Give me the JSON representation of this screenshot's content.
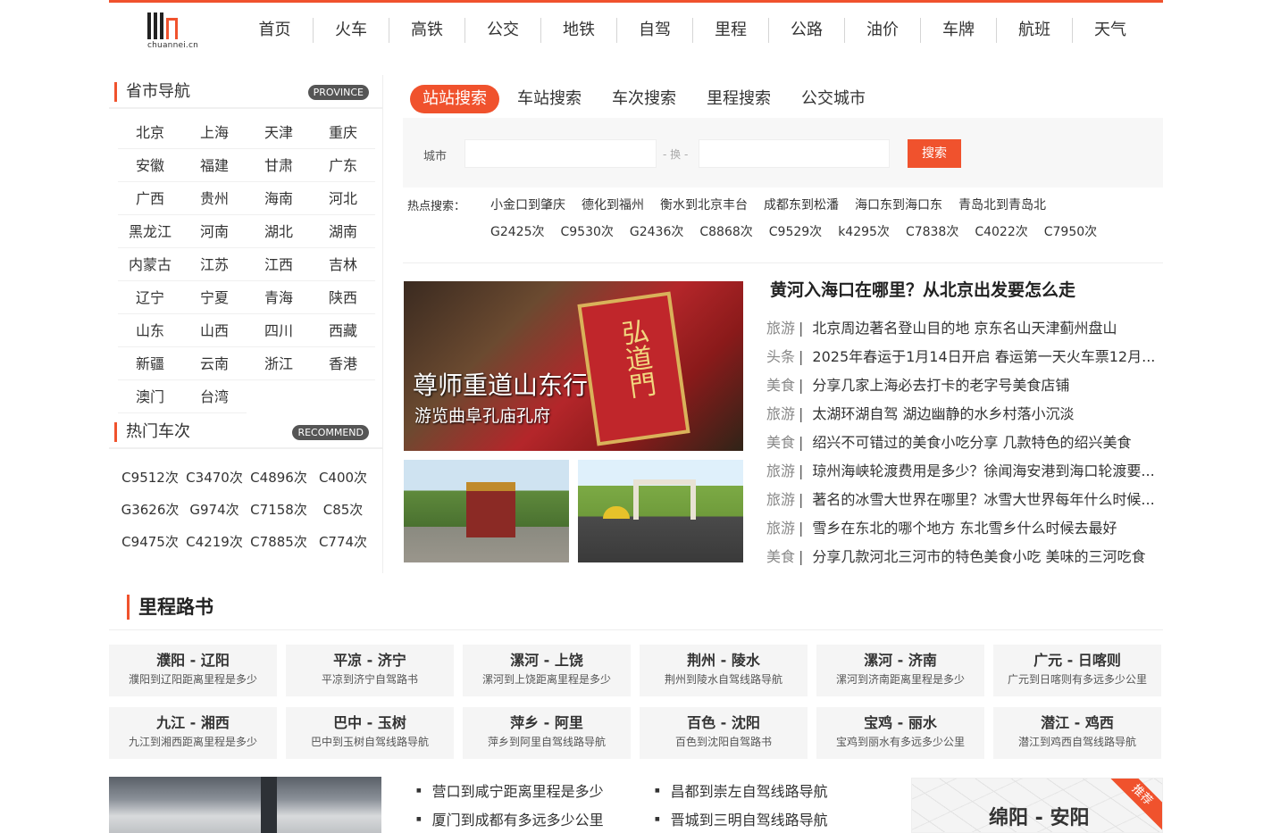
{
  "logo": {
    "site": "chuannei.cn"
  },
  "nav": [
    "首页",
    "火车",
    "高铁",
    "公交",
    "地铁",
    "自驾",
    "里程",
    "公路",
    "油价",
    "车牌",
    "航班",
    "天气"
  ],
  "province": {
    "title": "省市导航",
    "badge": "PROVINCE",
    "items": [
      "北京",
      "上海",
      "天津",
      "重庆",
      "安徽",
      "福建",
      "甘肃",
      "广东",
      "广西",
      "贵州",
      "海南",
      "河北",
      "黑龙江",
      "河南",
      "湖北",
      "湖南",
      "内蒙古",
      "江苏",
      "江西",
      "吉林",
      "辽宁",
      "宁夏",
      "青海",
      "陕西",
      "山东",
      "山西",
      "四川",
      "西藏",
      "新疆",
      "云南",
      "浙江",
      "香港",
      "澳门",
      "台湾"
    ]
  },
  "hot_trains": {
    "title": "热门车次",
    "badge": "RECOMMEND",
    "items": [
      "C9512次",
      "C3470次",
      "C4896次",
      "C400次",
      "G3626次",
      "G974次",
      "C7158次",
      "C85次",
      "C9475次",
      "C4219次",
      "C7885次",
      "C774次"
    ]
  },
  "search": {
    "tabs": [
      "站站搜索",
      "车站搜索",
      "车次搜索",
      "里程搜索",
      "公交城市"
    ],
    "city_label": "城市",
    "swap_label": "- 换 -",
    "button": "搜索",
    "hot_label": "热点搜索：",
    "hot_row1": [
      "小金口到肇庆",
      "德化到福州",
      "衡水到北京丰台",
      "成都东到松潘",
      "海口东到海口东",
      "青岛北到青岛北"
    ],
    "hot_row2": [
      "G2425次",
      "C9530次",
      "G2436次",
      "C8868次",
      "C9529次",
      "k4295次",
      "C7838次",
      "C4022次",
      "C7950次"
    ]
  },
  "feature": {
    "caption1": "尊师重道山东行",
    "caption2": "游览曲阜孔庙孔府",
    "sign": "弘道門"
  },
  "news": {
    "headline": "黄河入海口在哪里？从北京出发要怎么走",
    "items": [
      {
        "cat": "旅游",
        "title": "北京周边著名登山目的地 京东名山天津蓟州盘山"
      },
      {
        "cat": "头条",
        "title": "2025年春运于1月14日开启 春运第一天火车票12月..."
      },
      {
        "cat": "美食",
        "title": "分享几家上海必去打卡的老字号美食店铺"
      },
      {
        "cat": "旅游",
        "title": "太湖环湖自驾 湖边幽静的水乡村落小沉淡"
      },
      {
        "cat": "美食",
        "title": "绍兴不可错过的美食小吃分享 几款特色的绍兴美食"
      },
      {
        "cat": "旅游",
        "title": "琼州海峡轮渡费用是多少？徐闻海安港到海口轮渡要..."
      },
      {
        "cat": "旅游",
        "title": "著名的冰雪大世界在哪里？冰雪大世界每年什么时候..."
      },
      {
        "cat": "旅游",
        "title": "雪乡在东北的哪个地方 东北雪乡什么时候去最好"
      },
      {
        "cat": "美食",
        "title": "分享几款河北三河市的特色美食小吃 美味的三河吃食"
      }
    ]
  },
  "routes": {
    "title": "里程路书",
    "cards": [
      {
        "route": "濮阳 - 辽阳",
        "desc": "濮阳到辽阳距离里程是多少"
      },
      {
        "route": "平凉 - 济宁",
        "desc": "平凉到济宁自驾路书"
      },
      {
        "route": "漯河 - 上饶",
        "desc": "漯河到上饶距离里程是多少"
      },
      {
        "route": "荆州 - 陵水",
        "desc": "荆州到陵水自驾线路导航"
      },
      {
        "route": "漯河 - 济南",
        "desc": "漯河到济南距离里程是多少"
      },
      {
        "route": "广元 - 日喀则",
        "desc": "广元到日喀则有多远多少公里"
      },
      {
        "route": "九江 - 湘西",
        "desc": "九江到湘西距离里程是多少"
      },
      {
        "route": "巴中 - 玉树",
        "desc": "巴中到玉树自驾线路导航"
      },
      {
        "route": "萍乡 - 阿里",
        "desc": "萍乡到阿里自驾线路导航"
      },
      {
        "route": "百色 - 沈阳",
        "desc": "百色到沈阳自驾路书"
      },
      {
        "route": "宝鸡 - 丽水",
        "desc": "宝鸡到丽水有多远多少公里"
      },
      {
        "route": "潜江 - 鸡西",
        "desc": "潜江到鸡西自驾线路导航"
      }
    ]
  },
  "bottom": {
    "list1": [
      "营口到咸宁距离里程是多少",
      "厦门到成都有多远多少公里"
    ],
    "list2": [
      "昌都到崇左自驾线路导航",
      "晋城到三明自驾线路导航"
    ],
    "recommend_badge": "推荐",
    "recommend_route": "绵阳 - 安阳"
  },
  "colors": {
    "accent": "#f0522d"
  }
}
